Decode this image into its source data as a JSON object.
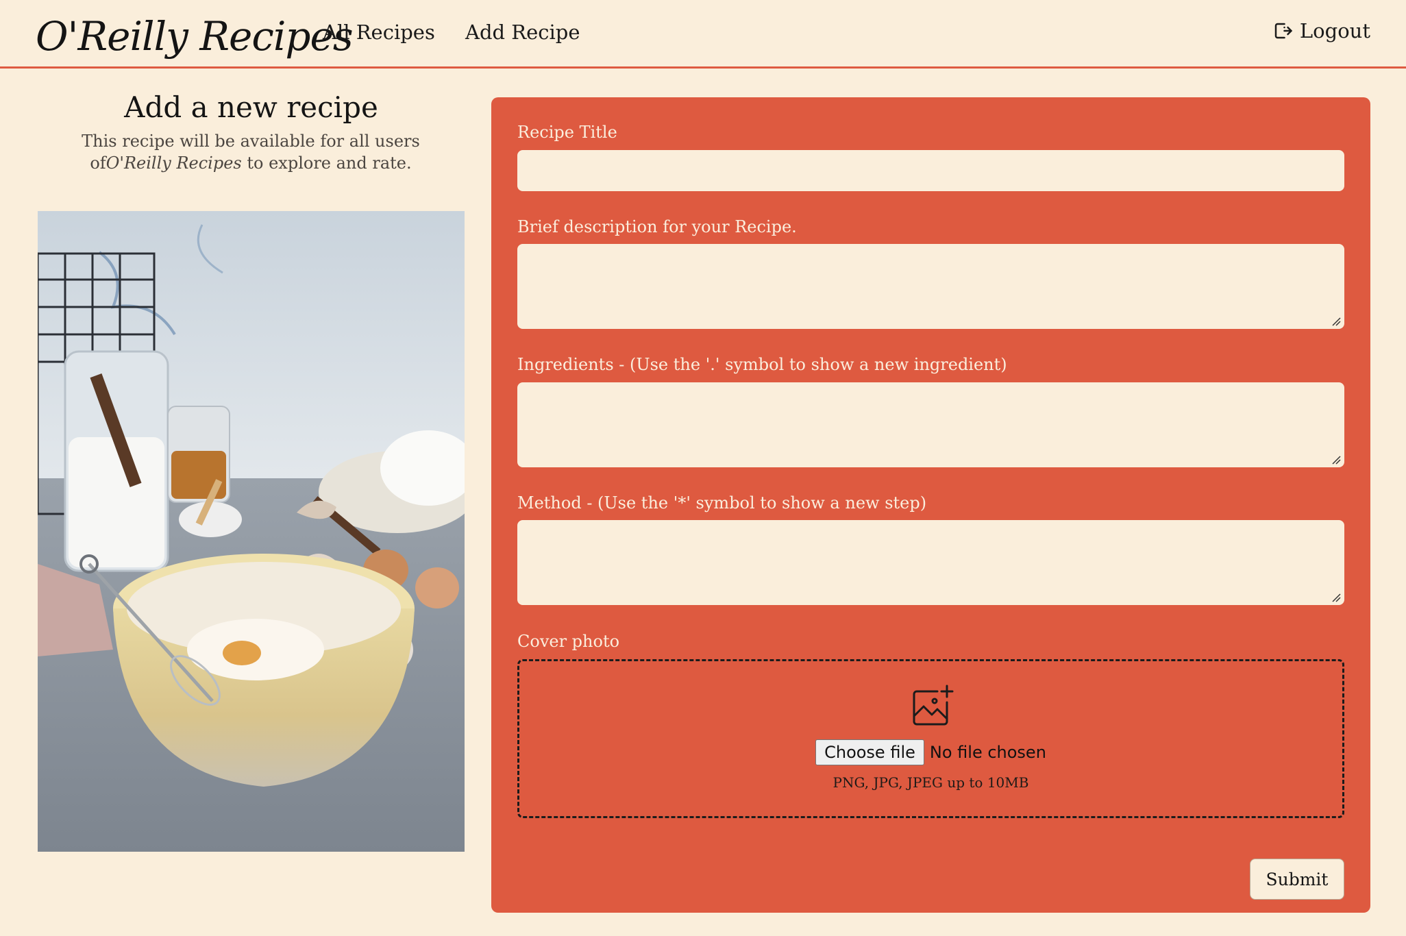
{
  "header": {
    "logo": "O'Reilly Recipes",
    "nav": {
      "all_recipes": "All Recipes",
      "add_recipe": "Add Recipe"
    },
    "logout": "Logout"
  },
  "intro": {
    "title": "Add a new recipe",
    "text_before": "This recipe will be available for all users of",
    "text_brand": "O'Reilly Recipes",
    "text_after": " to explore and rate."
  },
  "form": {
    "title_label": "Recipe Title",
    "title_value": "",
    "description_label": "Brief description for your Recipe.",
    "description_value": "",
    "ingredients_label": "Ingredients - (Use the '.' symbol to show a new ingredient)",
    "ingredients_value": "",
    "method_label": "Method - (Use the '*' symbol to show a new step)",
    "method_value": "",
    "cover_label": "Cover photo",
    "choose_file": "Choose file",
    "no_file": "No file chosen",
    "file_hint": "PNG, JPG, JPEG up to 10MB",
    "submit": "Submit"
  },
  "colors": {
    "page_bg": "#faeedb",
    "accent": "#de5a40",
    "text": "#141414"
  },
  "icons": {
    "logout": "logout-icon",
    "upload": "image-add-icon"
  }
}
